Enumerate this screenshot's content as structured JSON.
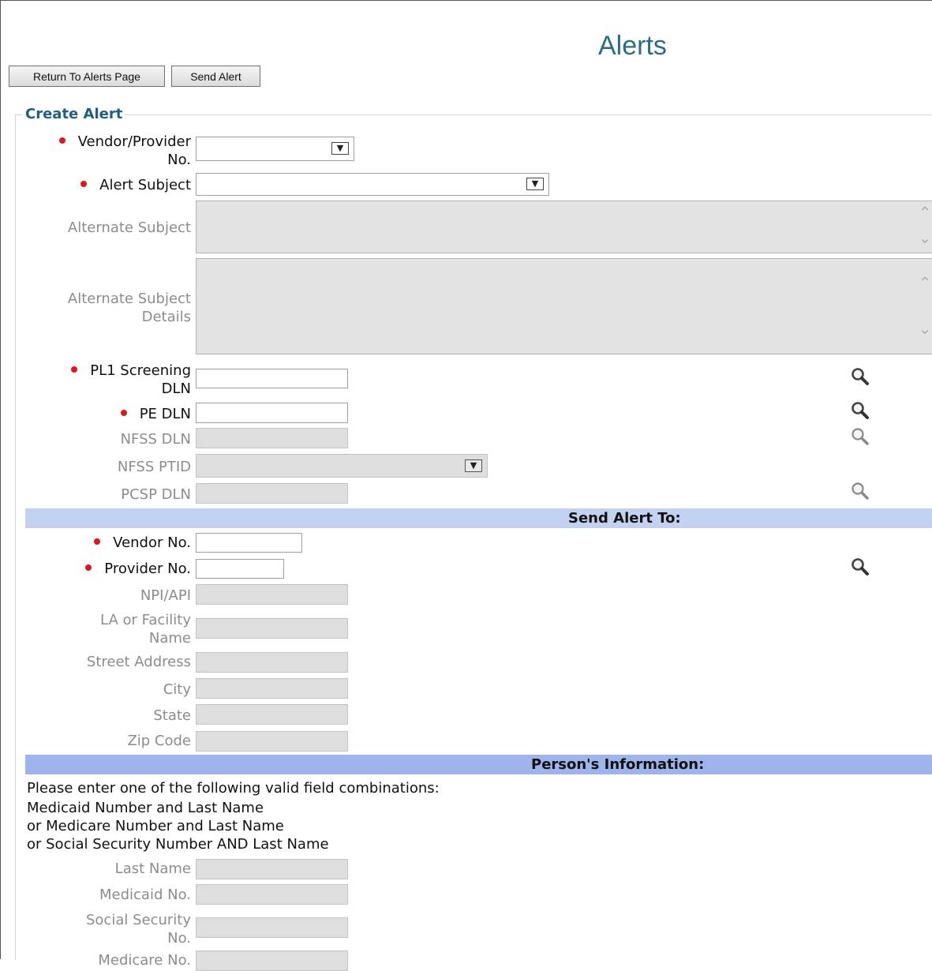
{
  "header": {
    "title": "Alerts"
  },
  "toolbar": {
    "return_label": "Return To Alerts Page",
    "send_label": "Send Alert"
  },
  "create_alert": {
    "legend": "Create Alert",
    "vendor_provider_no": {
      "label_line1": "Vendor/Provider",
      "label_line2": "No.",
      "value": ""
    },
    "alert_subject": {
      "label": "Alert Subject",
      "value": ""
    },
    "alternate_subject": {
      "label": "Alternate Subject",
      "value": ""
    },
    "alternate_subject_details": {
      "label_line1": "Alternate Subject",
      "label_line2": "Details",
      "value": ""
    },
    "pl1_screening_dln": {
      "label_line1": "PL1 Screening",
      "label_line2": "DLN",
      "value": ""
    },
    "pe_dln": {
      "label": "PE DLN",
      "value": ""
    },
    "nfss_dln": {
      "label": "NFSS DLN",
      "value": ""
    },
    "nfss_ptid": {
      "label": "NFSS PTID",
      "value": ""
    },
    "pcsp_dln": {
      "label": "PCSP DLN",
      "value": ""
    }
  },
  "send_alert_to": {
    "heading": "Send Alert To:",
    "vendor_no": {
      "label": "Vendor No.",
      "value": ""
    },
    "provider_no": {
      "label": "Provider No.",
      "value": ""
    },
    "npi_api": {
      "label": "NPI/API"
    },
    "la_facility_name": {
      "label_line1": "LA or Facility",
      "label_line2": "Name"
    },
    "street_address": {
      "label": "Street Address"
    },
    "city": {
      "label": "City"
    },
    "state": {
      "label": "State"
    },
    "zip_code": {
      "label": "Zip Code"
    }
  },
  "persons_information": {
    "heading": "Person's Information:",
    "instructions": [
      "Please enter one of the following valid field combinations:",
      "Medicaid Number and Last Name",
      "or Medicare Number and Last Name",
      "or Social Security Number AND Last Name"
    ],
    "last_name": {
      "label": "Last Name"
    },
    "medicaid_no": {
      "label": "Medicaid No."
    },
    "social_security_no": {
      "label_line1": "Social Security",
      "label_line2": "No."
    },
    "medicare_no": {
      "label": "Medicare No."
    }
  },
  "colors": {
    "title": "#2a6a8a",
    "legend": "#1f5f7f",
    "required_dot": "#e0161a",
    "section_bar_send": "#c4d2f2",
    "section_bar_person": "#9fb4ea",
    "disabled_field": "#dedede"
  },
  "icons": {
    "lookup": "magnifier-icon",
    "dropdown": "chevron-down-icon"
  }
}
